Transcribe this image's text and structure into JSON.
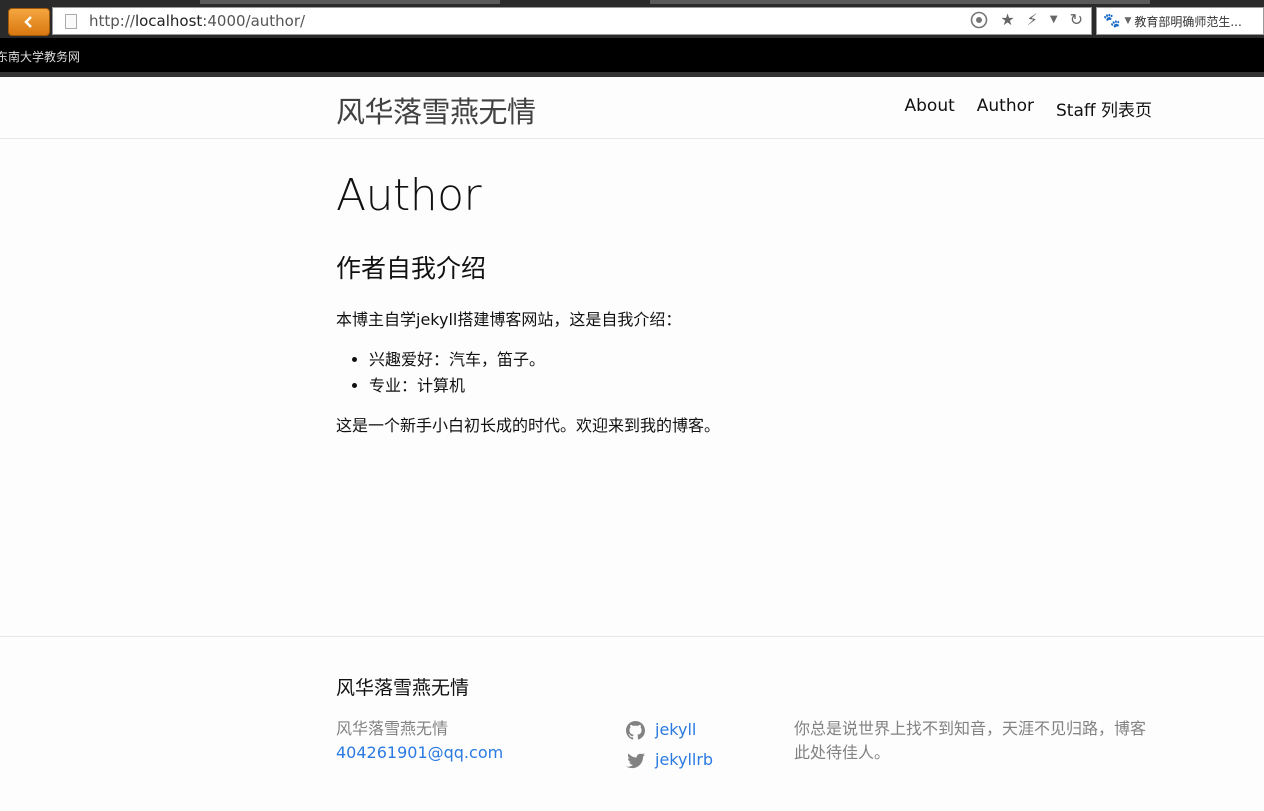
{
  "browser": {
    "url_prefix": "http://",
    "url_host": "localhost",
    "url_rest": ":4000/author/",
    "search_text": "教育部明确师范生...",
    "bookmark_item": "东南大学教务网",
    "icons": [
      "back-arrow-icon",
      "page-icon",
      "refresh-icon",
      "star-icon",
      "lightning-icon",
      "baidu-paw-icon"
    ]
  },
  "site": {
    "title": "风华落雪燕无情",
    "nav": {
      "about": "About",
      "author": "Author",
      "staff": "Staff 列表页"
    }
  },
  "post": {
    "title": "Author",
    "heading": "作者自我介绍",
    "intro": "本博主自学jekyll搭建博客网站，这是自我介绍：",
    "items": [
      "兴趣爱好：汽车，笛子。",
      "专业：计算机"
    ],
    "closing": "这是一个新手小白初长成的时代。欢迎来到我的博客。"
  },
  "footer": {
    "heading": "风华落雪燕无情",
    "name": "风华落雪燕无情",
    "email": "404261901@qq.com",
    "github": "jekyll",
    "twitter": "jekyllrb",
    "description": "你总是说世界上找不到知音，天涯不见归路，博客此处待佳人。"
  },
  "colors": {
    "accent": "#2a7ae2",
    "muted": "#828282",
    "back_button": "#e88a1a"
  }
}
